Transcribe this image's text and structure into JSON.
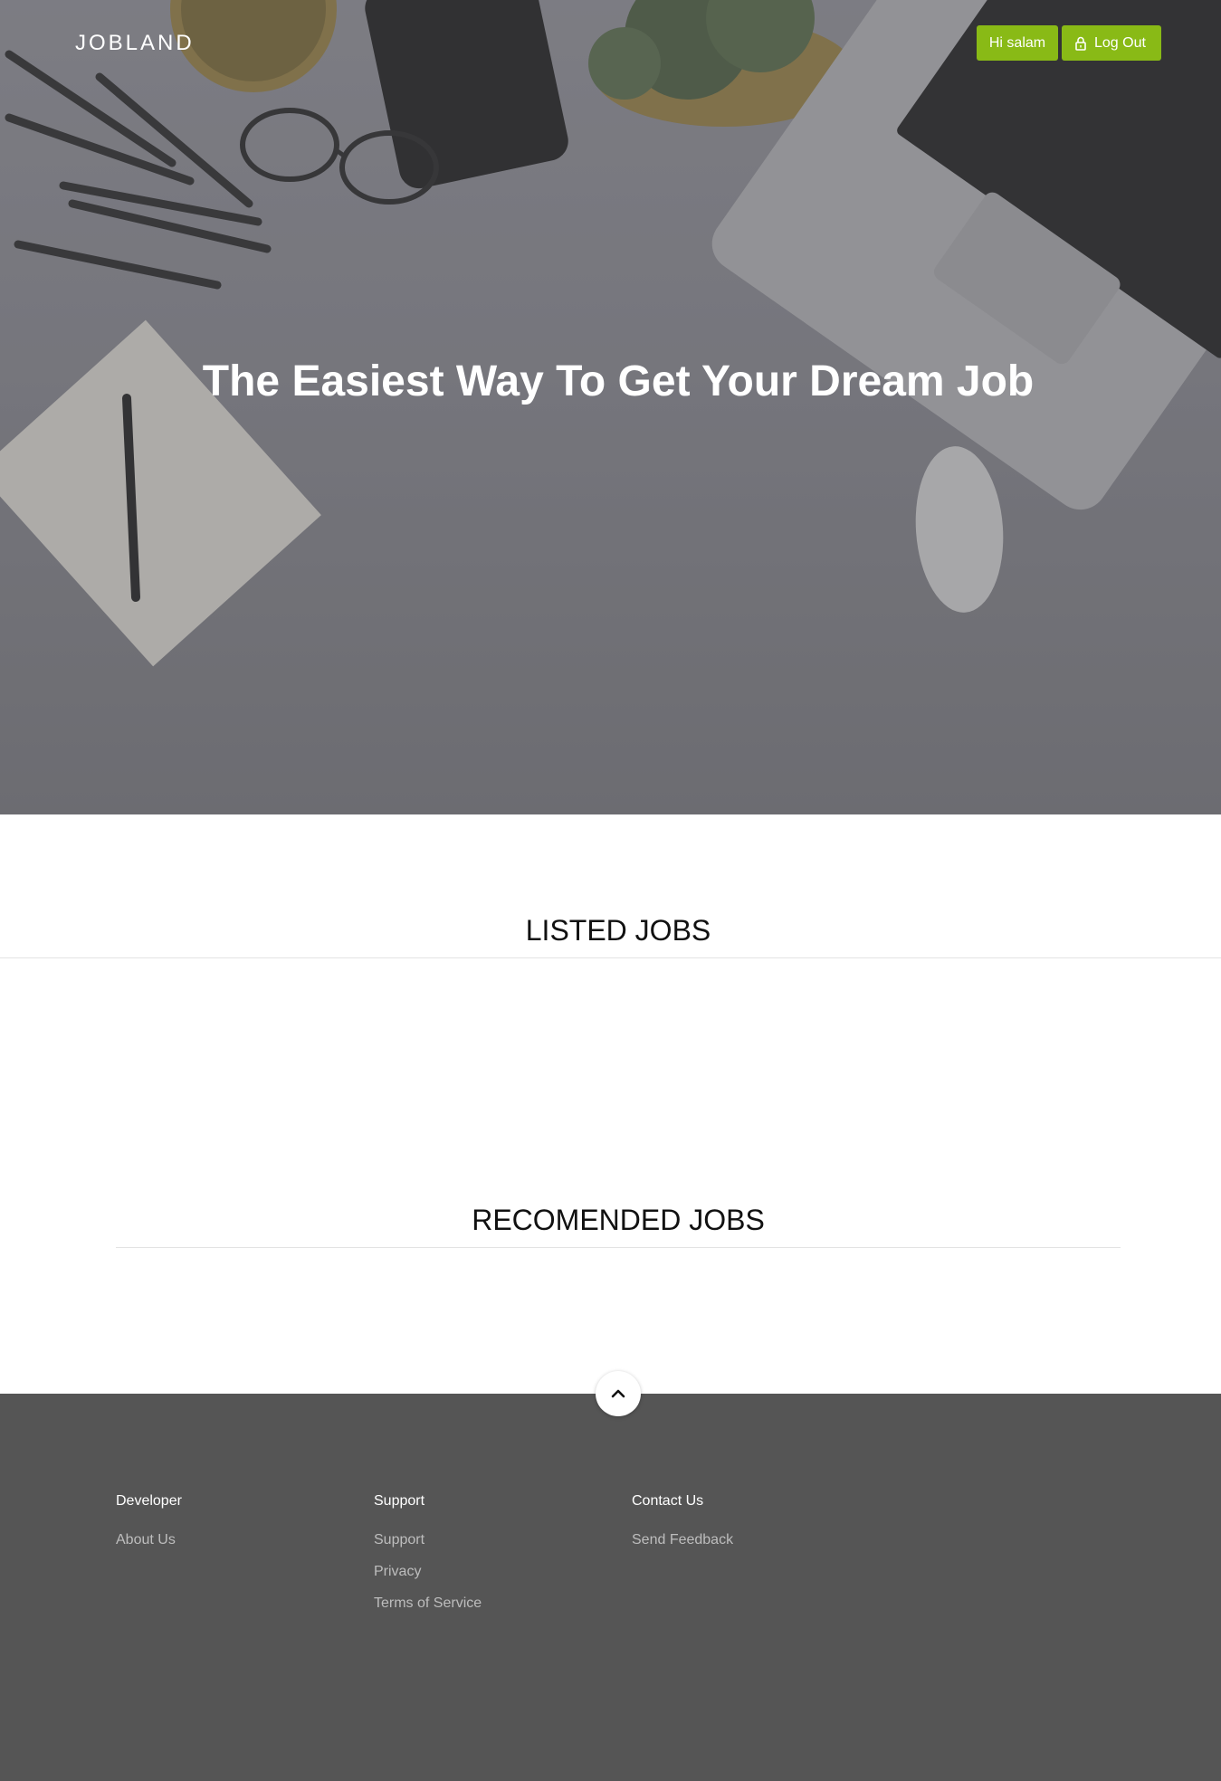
{
  "colors": {
    "accent": "#89ba16",
    "footer_bg": "#555555"
  },
  "header": {
    "brand": "JOBLAND",
    "greeting_button": "Hi salam",
    "logout_button": "Log Out",
    "logout_icon": "lock-icon"
  },
  "hero": {
    "title": "The Easiest Way To Get Your Dream Job"
  },
  "sections": {
    "listed_jobs": "LISTED JOBS",
    "recommended_jobs": "RECOMENDED JOBS"
  },
  "scroll_top_icon": "chevron-up-icon",
  "footer": {
    "columns": [
      {
        "title": "Developer",
        "links": [
          "About Us"
        ]
      },
      {
        "title": "Support",
        "links": [
          "Support",
          "Privacy",
          "Terms of Service"
        ]
      },
      {
        "title": "Contact Us",
        "links": [
          "Send Feedback"
        ]
      }
    ]
  }
}
